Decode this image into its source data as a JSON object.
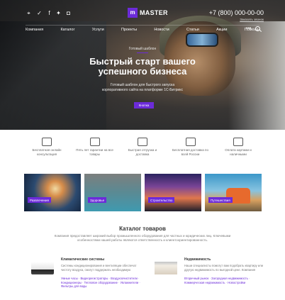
{
  "header": {
    "logo_mark": "m",
    "logo_text": "MASTER",
    "phone": "+7 (800) 000-00-00",
    "callback": "Заказать звонок"
  },
  "nav": [
    "Компания",
    "Каталог",
    "Услуги",
    "Проекты",
    "Новости",
    "Статьи",
    "Акции",
    "Помощь"
  ],
  "hero": {
    "subtitle": "Готовый шаблон",
    "title": "Быстрый старт вашего успешного бизнеса",
    "description": "Готовый шаблон для быстрого запуска корпоративного сайта на платформе 1С-Битрикс",
    "button": "Кнопка"
  },
  "features": [
    {
      "label": "Бесплатная онлайн консультация",
      "icon": "chat-icon"
    },
    {
      "label": "Пять лет гарантии на все товары",
      "icon": "document-icon"
    },
    {
      "label": "Быстрая отгрузка и доставка",
      "icon": "box-icon"
    },
    {
      "label": "Бесплатная доставка по всей России",
      "icon": "truck-icon"
    },
    {
      "label": "Оплата картами и наличными",
      "icon": "card-icon"
    }
  ],
  "categories": [
    {
      "label": "Развлечения"
    },
    {
      "label": "Здоровье"
    },
    {
      "label": "Строительство"
    },
    {
      "label": "Путешествия"
    }
  ],
  "catalog": {
    "title": "Каталог товаров",
    "description": "Компания предоставляет широкий выбор промышленного оборудования для частных и юридических лиц. Ключевыми особенностями нашей работы являются ответственность и клиентоориентированность.",
    "blocks": [
      {
        "title": "Климатические системы",
        "description": "Системы кондиционирования и вентиляции обеспечат чистоту воздуха, смогут поддержать необходимую",
        "links": "Умные часы · Видеорегистраторы · Воздухоочистители · Кондиционеры · Тепловое оборудование · Увлажнители · Фильтры для воды"
      },
      {
        "title": "Недвижимость",
        "description": "Наши специалисты помогут вам подобрать квартиру или другую недвижимость по выгодной цене. Компания",
        "links": "Вторичный рынок · Загородная недвижимость · Коммерческая недвижимость · Новостройки"
      }
    ]
  },
  "colors": {
    "accent": "#6c2bd9"
  }
}
